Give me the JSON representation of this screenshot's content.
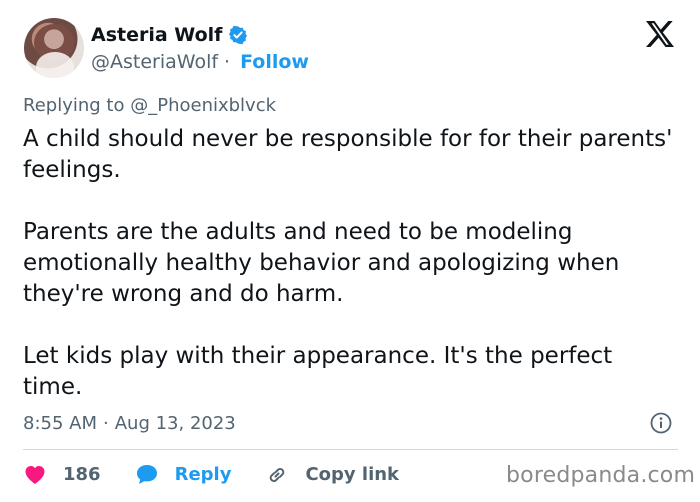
{
  "author": {
    "display_name": "Asteria Wolf",
    "handle": "@AsteriaWolf",
    "separator": "·",
    "follow_label": "Follow",
    "verified": true
  },
  "reply_context": {
    "prefix": "Replying to",
    "handle": "@_Phoenixblvck"
  },
  "tweet": {
    "paragraphs": [
      "A child should never be responsible for for their parents' feelings.",
      "Parents are the adults and need to be modeling emotionally healthy behavior and apologizing when they're wrong and do harm.",
      "Let kids play with their appearance. It's the perfect time."
    ],
    "time": "8:55 AM",
    "separator": "·",
    "date": "Aug 13, 2023"
  },
  "actions": {
    "likes_count": "186",
    "reply_label": "Reply",
    "copy_link_label": "Copy link"
  },
  "icons": {
    "verified": "verified-badge-icon",
    "brand": "x-logo-icon",
    "info": "info-icon",
    "like": "heart-icon",
    "reply": "reply-bubble-icon",
    "copy": "link-icon"
  },
  "colors": {
    "accent": "#1d9bf0",
    "like": "#f91880",
    "text": "#0f1419",
    "muted": "#536471"
  },
  "watermark": "boredpanda.com"
}
